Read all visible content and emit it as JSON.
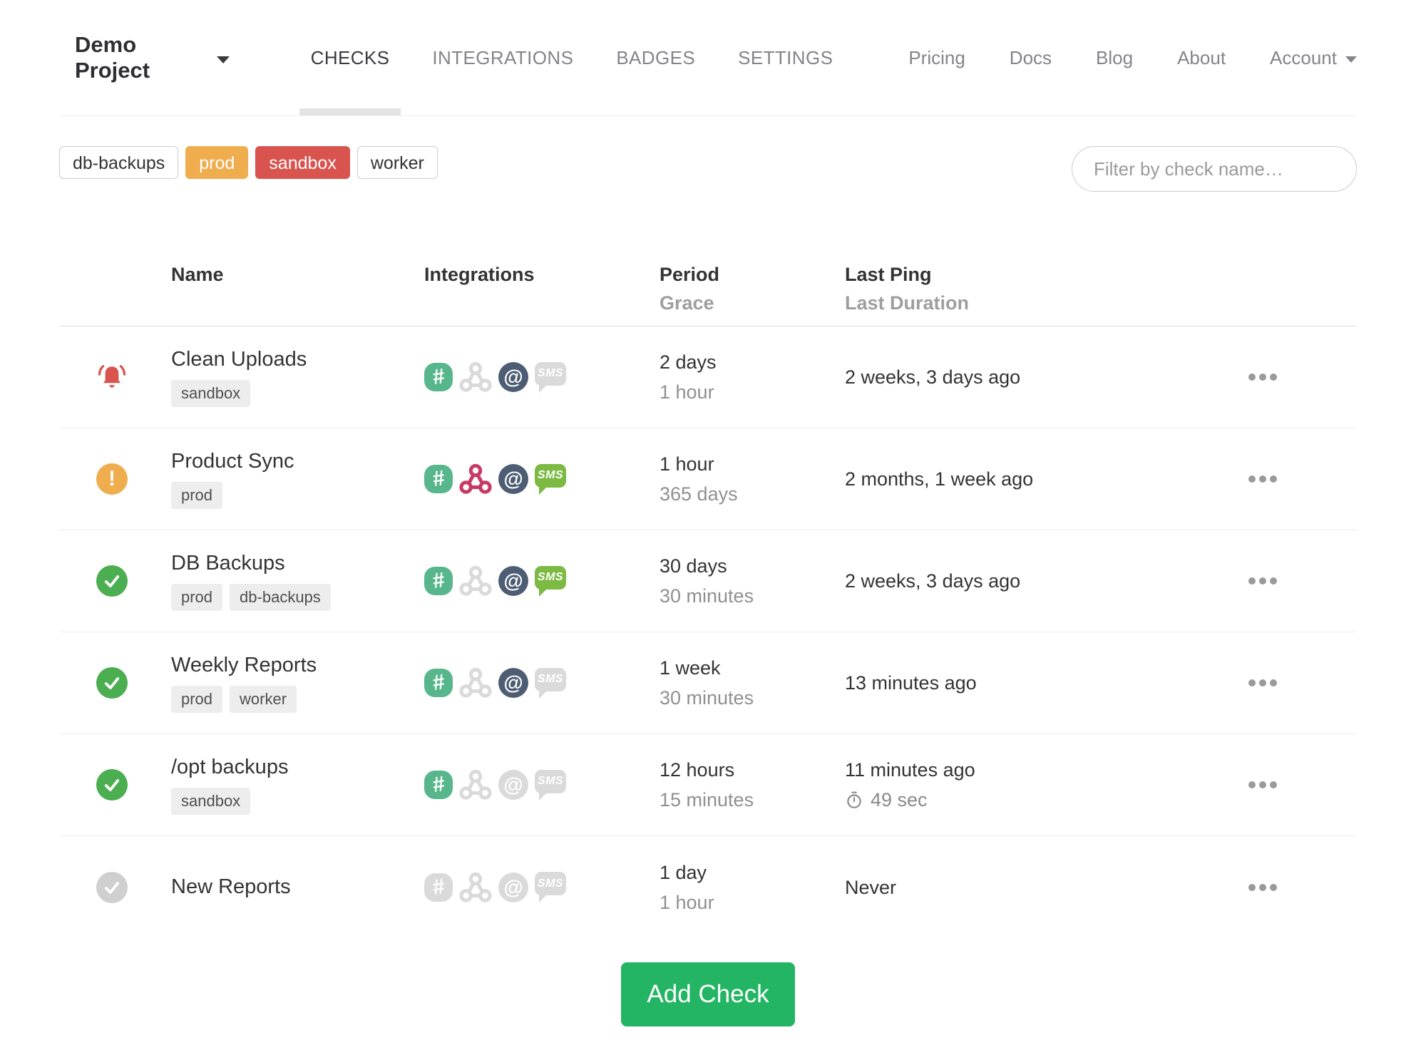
{
  "nav": {
    "project": "Demo Project",
    "tabs": [
      {
        "label": "CHECKS",
        "active": true
      },
      {
        "label": "INTEGRATIONS",
        "active": false
      },
      {
        "label": "BADGES",
        "active": false
      },
      {
        "label": "SETTINGS",
        "active": false
      }
    ],
    "links": [
      "Pricing",
      "Docs",
      "Blog",
      "About"
    ],
    "account_label": "Account"
  },
  "filters": {
    "tags": [
      {
        "label": "db-backups",
        "style": "default"
      },
      {
        "label": "prod",
        "style": "warning"
      },
      {
        "label": "sandbox",
        "style": "danger"
      },
      {
        "label": "worker",
        "style": "default"
      }
    ],
    "search_placeholder": "Filter by check name…"
  },
  "icons": {
    "slack_glyph": "#",
    "email_glyph": "@",
    "sms_glyph": "SMS"
  },
  "table": {
    "headers": {
      "name": "Name",
      "integrations": "Integrations",
      "period": "Period",
      "grace": "Grace",
      "last_ping": "Last Ping",
      "last_duration": "Last Duration"
    },
    "rows": [
      {
        "status": "alert",
        "name": "Clean Uploads",
        "tags": [
          "sandbox"
        ],
        "integrations": {
          "slack": true,
          "webhook": false,
          "email": true,
          "sms": false
        },
        "period": "2 days",
        "grace": "1 hour",
        "last_ping": "2 weeks, 3 days ago"
      },
      {
        "status": "warning",
        "name": "Product Sync",
        "tags": [
          "prod"
        ],
        "integrations": {
          "slack": true,
          "webhook": true,
          "email": true,
          "sms": true
        },
        "period": "1 hour",
        "grace": "365 days",
        "last_ping": "2 months, 1 week ago"
      },
      {
        "status": "ok",
        "name": "DB Backups",
        "tags": [
          "prod",
          "db-backups"
        ],
        "integrations": {
          "slack": true,
          "webhook": false,
          "email": true,
          "sms": true
        },
        "period": "30 days",
        "grace": "30 minutes",
        "last_ping": "2 weeks, 3 days ago"
      },
      {
        "status": "ok",
        "name": "Weekly Reports",
        "tags": [
          "prod",
          "worker"
        ],
        "integrations": {
          "slack": true,
          "webhook": false,
          "email": true,
          "sms": false
        },
        "period": "1 week",
        "grace": "30 minutes",
        "last_ping": "13 minutes ago"
      },
      {
        "status": "ok",
        "name": "/opt backups",
        "tags": [
          "sandbox"
        ],
        "integrations": {
          "slack": true,
          "webhook": false,
          "email": false,
          "sms": false
        },
        "period": "12 hours",
        "grace": "15 minutes",
        "last_ping": "11 minutes ago",
        "last_duration": "49 sec"
      },
      {
        "status": "new",
        "name": "New Reports",
        "tags": [],
        "integrations": {
          "slack": false,
          "webhook": false,
          "email": false,
          "sms": false
        },
        "period": "1 day",
        "grace": "1 hour",
        "last_ping": "Never"
      }
    ]
  },
  "add_check": {
    "label": "Add Check"
  },
  "colors": {
    "accent_green": "#24b564",
    "ok": "#4bae50",
    "warning": "#f0ad4e",
    "danger": "#d9534f",
    "new_gray": "#cfcfcf",
    "slack": "#57b68b",
    "webhook": "#c73a63",
    "email": "#4d5d73",
    "sms": "#7cba43",
    "inactive": "#dadada"
  }
}
